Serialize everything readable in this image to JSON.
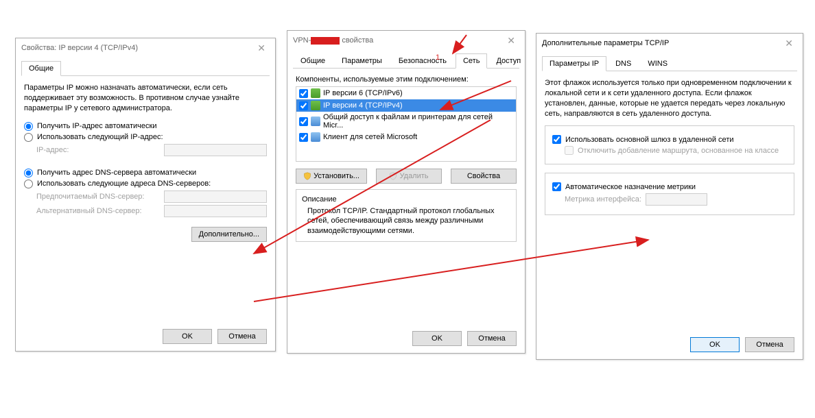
{
  "dialog1": {
    "title": "Свойства: IP версии 4 (TCP/IPv4)",
    "tabs": {
      "general": "Общие"
    },
    "intro": "Параметры IP можно назначать автоматически, если сеть поддерживает эту возможность. В противном случае узнайте параметры IP у сетевого администратора.",
    "radio_auto_ip": "Получить IP-адрес автоматически",
    "radio_manual_ip": "Использовать следующий IP-адрес:",
    "label_ip": "IP-адрес:",
    "radio_auto_dns": "Получить адрес DNS-сервера автоматически",
    "radio_manual_dns": "Использовать следующие адреса DNS-серверов:",
    "label_dns1": "Предпочитаемый DNS-сервер:",
    "label_dns2": "Альтернативный DNS-сервер:",
    "btn_advanced": "Дополнительно...",
    "btn_ok": "OK",
    "btn_cancel": "Отмена"
  },
  "dialog2": {
    "title_prefix": "VPN-",
    "title_suffix": " свойства",
    "tabs": {
      "general": "Общие",
      "params": "Параметры",
      "security": "Безопасность",
      "network": "Сеть",
      "access": "Доступ"
    },
    "list_label": "Компоненты, используемые этим подключением:",
    "items": [
      {
        "label": "IP версии 6 (TCP/IPv6)",
        "checked": true
      },
      {
        "label": "IP версии 4 (TCP/IPv4)",
        "checked": true,
        "selected": true
      },
      {
        "label": "Общий доступ к файлам и принтерам для сетей Micr...",
        "checked": true
      },
      {
        "label": "Клиент для сетей Microsoft",
        "checked": true
      }
    ],
    "btn_install": "Установить...",
    "btn_remove": "Удалить",
    "btn_props": "Свойства",
    "desc_label": "Описание",
    "desc_text": "Протокол TCP/IP. Стандартный протокол глобальных сетей, обеспечивающий связь между различными взаимодействующими сетями.",
    "btn_ok": "OK",
    "btn_cancel": "Отмена"
  },
  "dialog3": {
    "title": "Дополнительные параметры TCP/IP",
    "tabs": {
      "ip": "Параметры IP",
      "dns": "DNS",
      "wins": "WINS"
    },
    "intro": "Этот флажок используется только при одновременном подключении к локальной сети и к сети удаленного доступа. Если флажок установлен, данные, которые не удается передать через локальную сеть, направляются в сеть удаленного доступа.",
    "check_gateway": "Использовать основной шлюз в удаленной сети",
    "check_class_route": "Отключить добавление маршрута, основанное на классе",
    "check_auto_metric": "Автоматическое назначение метрики",
    "label_metric": "Метрика интерфейса:",
    "btn_ok": "OK",
    "btn_cancel": "Отмена"
  },
  "annot": {
    "num1": "1"
  }
}
